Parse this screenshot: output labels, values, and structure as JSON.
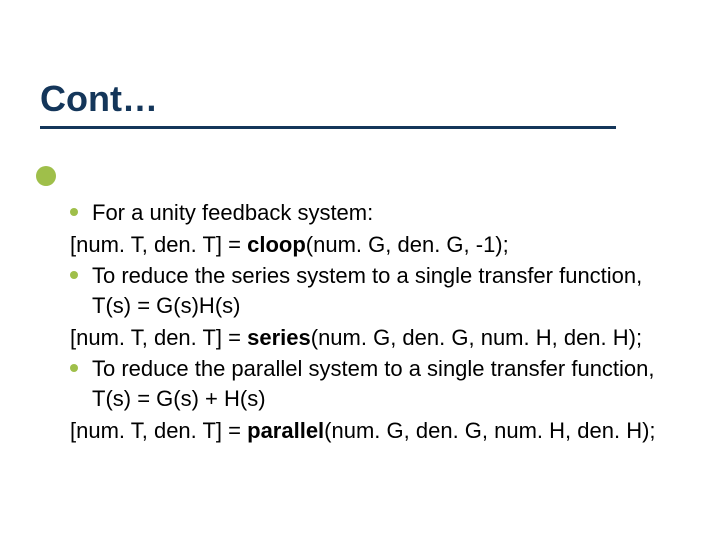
{
  "title": "Cont…",
  "lines": [
    {
      "type": "bullet",
      "runs": [
        {
          "t": "For a unity feedback system:"
        }
      ]
    },
    {
      "type": "plain",
      "runs": [
        {
          "t": "[num. T, den. T] = "
        },
        {
          "t": "cloop",
          "b": true
        },
        {
          "t": "(num. G, den. G, -1);"
        }
      ]
    },
    {
      "type": "bullet",
      "runs": [
        {
          "t": "To reduce the series system to a single transfer function, T(s) = G(s)H(s)"
        }
      ]
    },
    {
      "type": "plain",
      "runs": [
        {
          "t": "[num. T, den. T] = "
        },
        {
          "t": "series",
          "b": true
        },
        {
          "t": "(num. G, den. G, num. H, den. H);"
        }
      ]
    },
    {
      "type": "bullet",
      "runs": [
        {
          "t": "To reduce the parallel system to a single transfer function, T(s) = G(s) + H(s)"
        }
      ]
    },
    {
      "type": "plain",
      "runs": [
        {
          "t": "[num. T, den. T] = "
        },
        {
          "t": "parallel",
          "b": true
        },
        {
          "t": "(num. G, den. G, num. H, den. H);"
        }
      ]
    }
  ]
}
